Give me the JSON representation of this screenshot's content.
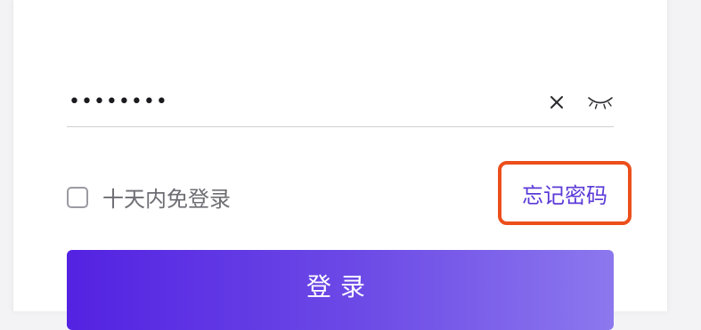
{
  "password_field": {
    "value": "••••••••",
    "clear_icon": "close-icon",
    "visibility_icon": "eye-closed-icon"
  },
  "remember": {
    "label": "十天内免登录",
    "checked": false
  },
  "forgot_password": {
    "label": "忘记密码",
    "highlight_color": "#ec4f1c",
    "link_color": "#5b3ad8"
  },
  "login_button": {
    "label": "登录",
    "gradient": [
      "#5322e2",
      "#8c78ee"
    ]
  }
}
